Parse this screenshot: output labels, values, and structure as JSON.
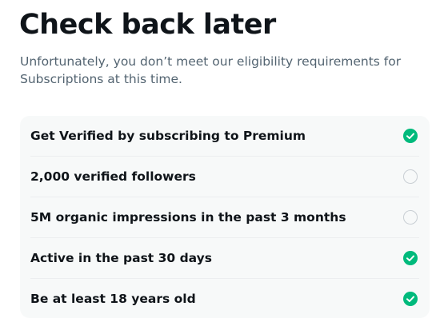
{
  "header": {
    "title": "Check back later",
    "subtitle": "Unfortunately, you don’t meet our eligibility requirements for Subscriptions at this time."
  },
  "requirements": [
    {
      "label": "Get Verified by subscribing to Premium",
      "status": "done",
      "status_icon": "check-circle-icon"
    },
    {
      "label": "2,000 verified followers",
      "status": "pending",
      "status_icon": "empty-circle-icon"
    },
    {
      "label": "5M organic impressions in the past 3 months",
      "status": "pending",
      "status_icon": "empty-circle-icon"
    },
    {
      "label": "Active in the past 30 days",
      "status": "done",
      "status_icon": "check-circle-icon"
    },
    {
      "label": "Be at least 18 years old",
      "status": "done",
      "status_icon": "check-circle-icon"
    }
  ],
  "colors": {
    "text_primary": "#0f1419",
    "text_secondary": "#536471",
    "card_background": "#f7f9f9",
    "success_green": "#00ba7c",
    "pending_outline": "#c8ced3"
  }
}
